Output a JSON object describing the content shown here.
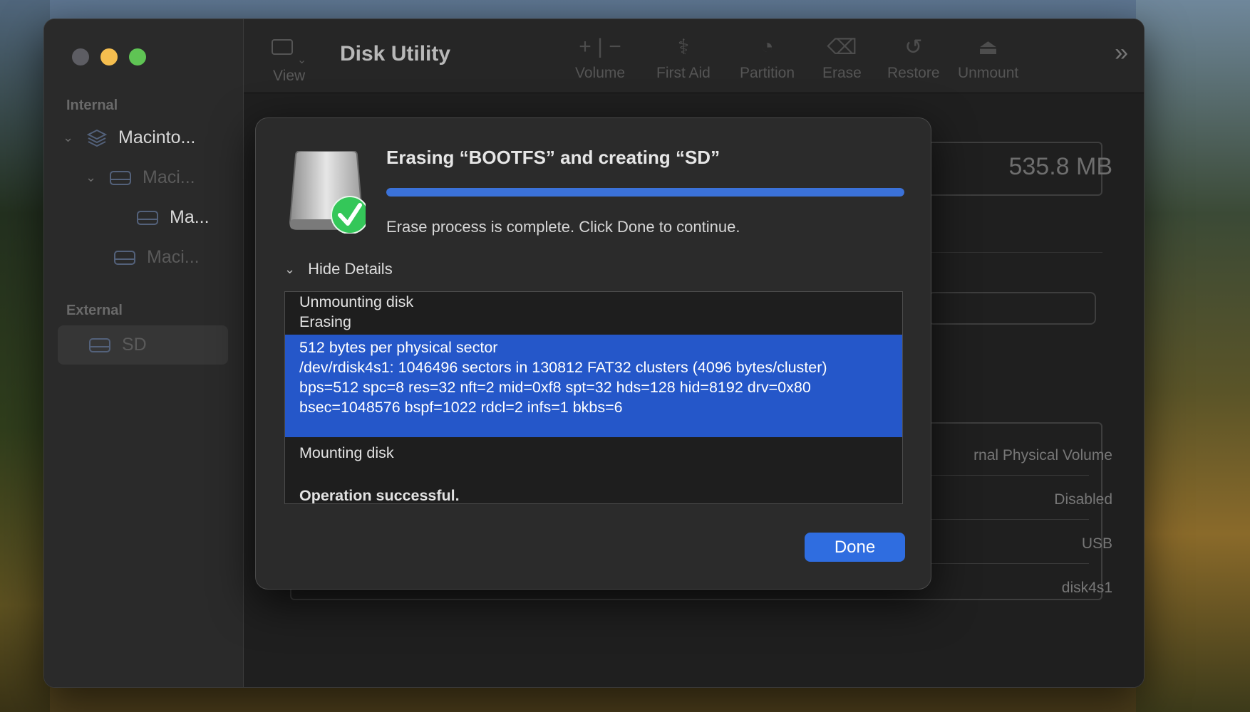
{
  "window": {
    "title": "Disk Utility"
  },
  "sidebar": {
    "section_internal": "Internal",
    "section_external": "External",
    "items": [
      {
        "label": "Macinto...",
        "icon": "stack-icon"
      },
      {
        "label": "Maci...",
        "icon": "drive-icon"
      },
      {
        "label": "Ma...",
        "icon": "drive-icon"
      },
      {
        "label": "Maci...",
        "icon": "drive-icon"
      },
      {
        "label": "SD",
        "icon": "drive-icon"
      }
    ]
  },
  "toolbar": {
    "view_label": "View",
    "buttons": [
      {
        "label": "Volume",
        "icon": "plus-minus-icon"
      },
      {
        "label": "First Aid",
        "icon": "stethoscope-icon"
      },
      {
        "label": "Partition",
        "icon": "pie-icon"
      },
      {
        "label": "Erase",
        "icon": "eraser-icon"
      },
      {
        "label": "Restore",
        "icon": "restore-icon"
      },
      {
        "label": "Unmount",
        "icon": "eject-icon"
      }
    ]
  },
  "background": {
    "size": "535.8 MB",
    "rows": [
      "rnal Physical Volume",
      "Disabled",
      "USB",
      "disk4s1"
    ]
  },
  "dialog": {
    "title": "Erasing “BOOTFS” and creating “SD”",
    "progress": 1.0,
    "message": "Erase process is complete. Click Done to continue.",
    "details_toggle": "Hide Details",
    "log": {
      "before": [
        "Unmounting disk",
        "Erasing"
      ],
      "selected": [
        "512 bytes per physical sector",
        "/dev/rdisk4s1: 1046496 sectors in 130812 FAT32 clusters (4096 bytes/cluster)",
        "bps=512 spc=8 res=32 nft=2 mid=0xf8 spt=32 hds=128 hid=8192 drv=0x80",
        "bsec=1048576 bspf=1022 rdcl=2 infs=1 bkbs=6"
      ],
      "after": [
        "Mounting disk"
      ],
      "result": "Operation successful."
    },
    "done_label": "Done"
  },
  "colors": {
    "accent": "#2f6de0",
    "selection": "#2557c9",
    "success": "#34c759"
  }
}
